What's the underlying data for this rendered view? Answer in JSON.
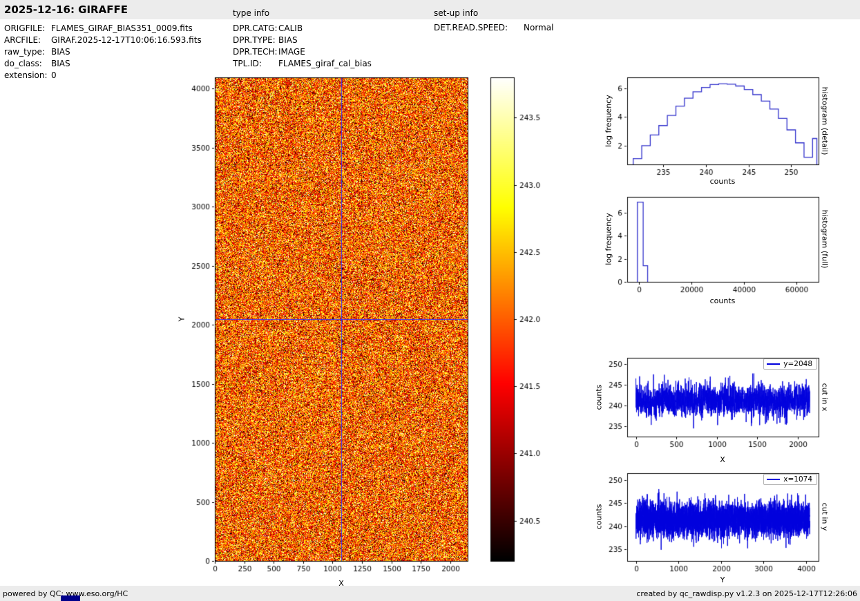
{
  "header": {
    "title": "2025-12-16: GIRAFFE",
    "type_info": "type info",
    "setup_info": "set-up info"
  },
  "meta": {
    "left": [
      {
        "label": "ORIGFILE:",
        "value": "FLAMES_GIRAF_BIAS351_0009.fits"
      },
      {
        "label": "ARCFILE:",
        "value": "GIRAF.2025-12-17T10:06:16.593.fits"
      },
      {
        "label": "raw_type:",
        "value": "BIAS"
      },
      {
        "label": "do_class:",
        "value": "BIAS"
      },
      {
        "label": "extension:",
        "value": "0"
      }
    ],
    "middle": [
      {
        "label": "DPR.CATG:",
        "value": "CALIB"
      },
      {
        "label": "DPR.TYPE:",
        "value": "BIAS"
      },
      {
        "label": "DPR.TECH:",
        "value": "IMAGE"
      },
      {
        "label": "TPL.ID:",
        "value": "FLAMES_giraf_cal_bias"
      }
    ],
    "right": [
      {
        "label": "DET.READ.SPEED:",
        "value": "Normal"
      }
    ]
  },
  "footer": {
    "left": "powered by QC: www.eso.org/HC",
    "right": "created by qc_rawdisp.py v1.2.3 on 2025-12-17T12:26:06"
  },
  "colors": {
    "bar_bg": "#ececec",
    "hist_line": "#3333cc",
    "cut_line": "#0000dd",
    "crosshair": "#3333ff",
    "accent_strip": "#00008b",
    "colormap_stops": [
      [
        "0.0",
        "#000000"
      ],
      [
        "0.365",
        "#ff0000"
      ],
      [
        "0.73",
        "#ffff00"
      ],
      [
        "1.0",
        "#ffffff"
      ]
    ]
  },
  "chart_data": {
    "main_image": {
      "type": "heatmap",
      "xlabel": "X",
      "ylabel": "Y",
      "xlim": [
        0,
        2148
      ],
      "ylim": [
        0,
        4096
      ],
      "xticks": [
        0,
        250,
        500,
        750,
        1000,
        1250,
        1500,
        1750,
        2000
      ],
      "yticks": [
        0,
        500,
        1000,
        1500,
        2000,
        2500,
        3000,
        3500,
        4000
      ],
      "colormap": "hot",
      "crosshair": {
        "x": 1074,
        "y": 2048
      },
      "noise": {
        "seed": 42,
        "mean": 0.5,
        "sd": 0.24
      }
    },
    "colorbar": {
      "type": "colorbar",
      "colormap": "hot",
      "vmin": 240.2,
      "vmax": 243.8,
      "ticks": [
        240.5,
        241.0,
        241.5,
        242.0,
        242.5,
        243.0,
        243.5
      ],
      "tick_labels": [
        "240.5",
        "241.0",
        "241.5",
        "242.0",
        "242.5",
        "243.0",
        "243.5"
      ]
    },
    "hist_detail": {
      "type": "histogram-step",
      "side_label": "histogram (detail)",
      "xlabel": "counts",
      "ylabel": "log frequency",
      "xlim": [
        230.8,
        253.2
      ],
      "ylim": [
        0.7,
        6.75
      ],
      "xticks": [
        235,
        240,
        245,
        250
      ],
      "yticks": [
        2,
        4,
        6
      ],
      "bin_edges": [
        231.5,
        232.5,
        233.5,
        234.5,
        235.5,
        236.5,
        237.5,
        238.5,
        239.5,
        240.5,
        241.5,
        242.5,
        243.5,
        244.5,
        245.5,
        246.5,
        247.5,
        248.5,
        249.5,
        250.5,
        251.5,
        252.5,
        253.0
      ],
      "log_freq": [
        1.1,
        2.0,
        2.75,
        3.4,
        4.1,
        4.75,
        5.3,
        5.75,
        6.05,
        6.25,
        6.3,
        6.28,
        6.15,
        5.9,
        5.55,
        5.1,
        4.55,
        3.9,
        3.1,
        2.2,
        1.2,
        2.5
      ],
      "baseline": 0.7
    },
    "hist_full": {
      "type": "histogram-step",
      "side_label": "histogram (full)",
      "xlabel": "counts",
      "ylabel": "log frequency",
      "xlim": [
        -4600,
        68500
      ],
      "ylim": [
        0,
        7.35
      ],
      "xticks": [
        0,
        20000,
        40000,
        60000
      ],
      "yticks": [
        0,
        2,
        4,
        6
      ],
      "bin_edges": [
        -700,
        1500,
        3200
      ],
      "log_freq": [
        6.9,
        1.4
      ],
      "baseline": 0
    },
    "cut_x": {
      "type": "line",
      "legend": "y=2048",
      "side_label": "cut in x",
      "xlabel": "X",
      "ylabel": "counts",
      "xlim": [
        -107,
        2255
      ],
      "ylim": [
        232.5,
        251.5
      ],
      "xticks": [
        0,
        500,
        1000,
        1500,
        2000
      ],
      "yticks": [
        235,
        240,
        245,
        250
      ],
      "noise": {
        "n": 2148,
        "seed": 7,
        "mean": 241.3,
        "sd": 1.9,
        "clip": [
          233.5,
          249.5
        ]
      }
    },
    "cut_y": {
      "type": "line",
      "legend": "x=1074",
      "side_label": "cut in y",
      "xlabel": "Y",
      "ylabel": "counts",
      "xlim": [
        -205,
        4300
      ],
      "ylim": [
        232.5,
        251.5
      ],
      "xticks": [
        0,
        1000,
        2000,
        3000,
        4000
      ],
      "yticks": [
        235,
        240,
        245,
        250
      ],
      "noise": {
        "n": 4096,
        "seed": 11,
        "mean": 241.5,
        "sd": 1.9,
        "clip": [
          233.5,
          250.0
        ]
      }
    }
  }
}
